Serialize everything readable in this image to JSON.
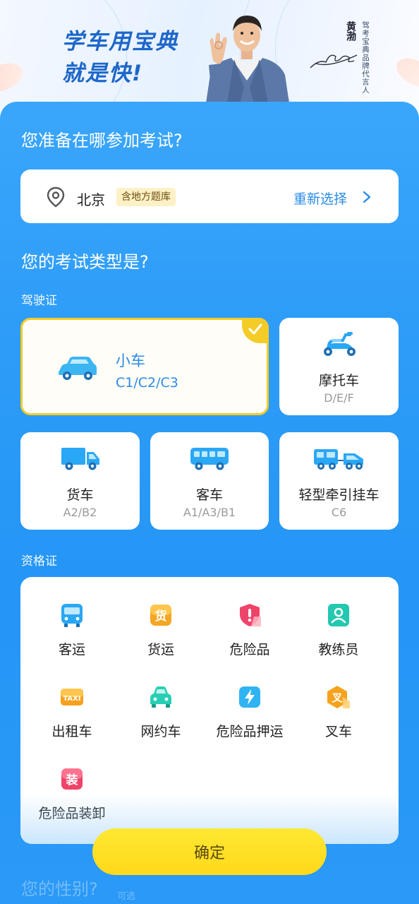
{
  "banner": {
    "slogan_line1": "学车用宝典",
    "slogan_line2": "就是快!",
    "spokesperson_name": "黄渤",
    "spokesperson_role": "驾考宝典品牌代言人",
    "signature_name": "黄渤"
  },
  "location": {
    "question": "您准备在哪参加考试?",
    "city": "北京",
    "tag": "含地方题库",
    "reselect": "重新选择"
  },
  "exam_type": {
    "question": "您的考试类型是?",
    "license_section": "驾驶证",
    "vehicles": [
      {
        "name": "小车",
        "code": "C1/C2/C3",
        "selected": true,
        "icon": "car-icon"
      },
      {
        "name": "摩托车",
        "code": "D/E/F",
        "selected": false,
        "icon": "motorcycle-icon"
      },
      {
        "name": "货车",
        "code": "A2/B2",
        "selected": false,
        "icon": "truck-icon"
      },
      {
        "name": "客车",
        "code": "A1/A3/B1",
        "selected": false,
        "icon": "bus-icon"
      },
      {
        "name": "轻型牵引挂车",
        "code": "C6",
        "selected": false,
        "icon": "trailer-icon"
      }
    ],
    "qualification_section": "资格证",
    "qualifications": [
      {
        "label": "客运",
        "icon": "passenger-bus-icon",
        "color": "#2aa7f5"
      },
      {
        "label": "货运",
        "icon": "cargo-icon",
        "color": "#f5a623",
        "glyph": "货"
      },
      {
        "label": "危险品",
        "icon": "hazard-shield-icon",
        "color": "#f0436a"
      },
      {
        "label": "教练员",
        "icon": "instructor-icon",
        "color": "#23c8b0"
      },
      {
        "label": "出租车",
        "icon": "taxi-icon",
        "color": "#f7a21d",
        "glyph": "TAXI"
      },
      {
        "label": "网约车",
        "icon": "ride-hailing-car-icon",
        "color": "#28cfb6"
      },
      {
        "label": "危险品押运",
        "icon": "escort-bolt-icon",
        "color": "#2fb4f3"
      },
      {
        "label": "叉车",
        "icon": "forklift-icon",
        "color": "#f7a21d",
        "glyph": "叉"
      },
      {
        "label": "危险品装卸",
        "icon": "loading-icon",
        "color": "#f0436a",
        "glyph": "装"
      }
    ]
  },
  "confirm_label": "确定",
  "next_section": {
    "question": "您的性别?",
    "hint": "可选"
  },
  "colors": {
    "panel_blue": "#2d9cf8",
    "accent_blue": "#2a8be8",
    "selected_yellow": "#f4cc27",
    "confirm_yellow": "#ffde1f",
    "slogan_blue": "#1e67c9"
  }
}
